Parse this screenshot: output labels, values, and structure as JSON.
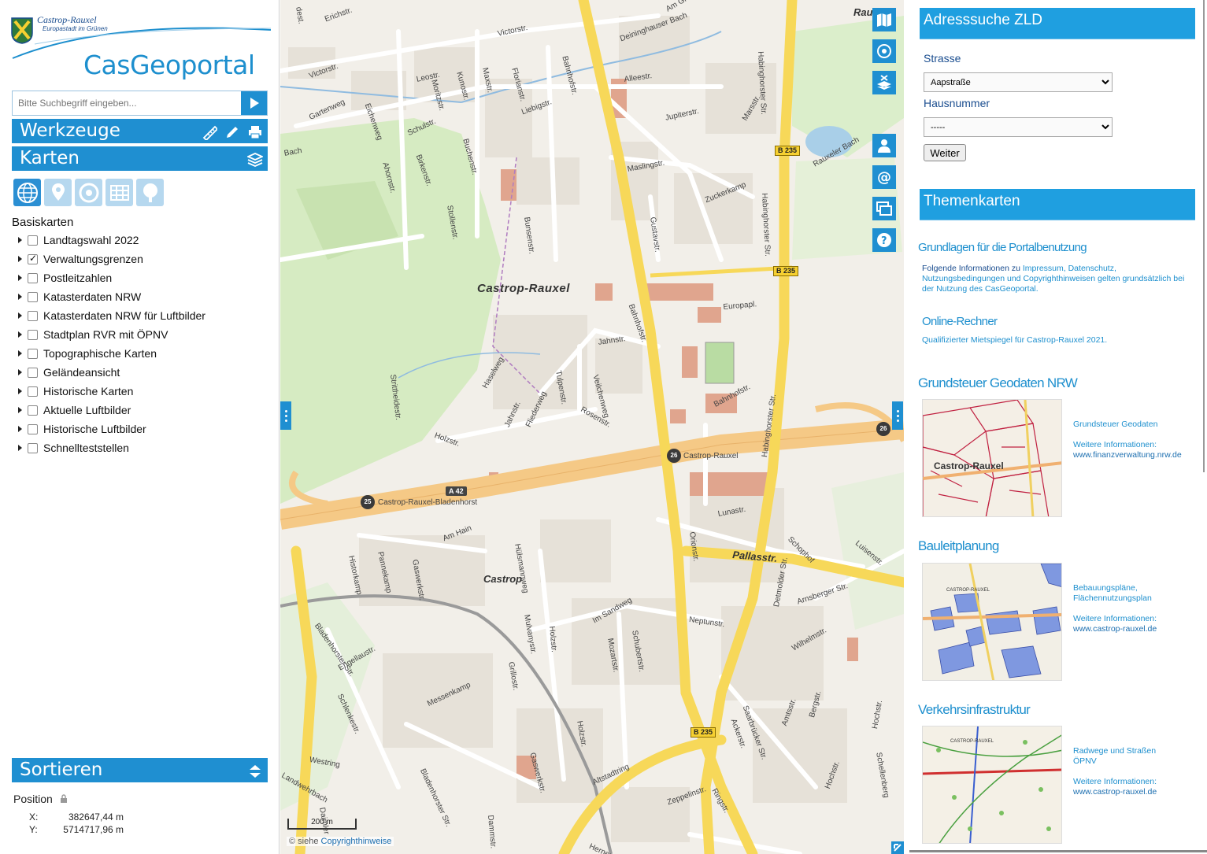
{
  "brand": {
    "city": "Castrop-Rauxel",
    "tagline": "Europastadt im Grünen",
    "title": "CasGeoportal"
  },
  "search": {
    "placeholder": "Bitte Suchbegriff eingeben..."
  },
  "sections": {
    "werkzeuge": "Werkzeuge",
    "karten": "Karten",
    "sortieren": "Sortieren"
  },
  "basiskarten": {
    "title": "Basiskarten",
    "layers": [
      {
        "label": "Landtagswahl 2022",
        "checked": false
      },
      {
        "label": "Verwaltungsgrenzen",
        "checked": true
      },
      {
        "label": "Postleitzahlen",
        "checked": false
      },
      {
        "label": "Katasterdaten NRW",
        "checked": false
      },
      {
        "label": "Katasterdaten NRW für Luftbilder",
        "checked": false
      },
      {
        "label": "Stadtplan RVR mit ÖPNV",
        "checked": false
      },
      {
        "label": "Topographische Karten",
        "checked": false
      },
      {
        "label": "Geländeansicht",
        "checked": false
      },
      {
        "label": "Historische Karten",
        "checked": false
      },
      {
        "label": "Aktuelle Luftbilder",
        "checked": false
      },
      {
        "label": "Historische Luftbilder",
        "checked": false
      },
      {
        "label": "Schnellteststellen",
        "checked": false
      }
    ]
  },
  "position": {
    "label": "Position",
    "x_label": "X:",
    "x_value": "382647,44 m",
    "y_label": "Y:",
    "y_value": "5714717,96 m"
  },
  "map": {
    "labels": {
      "victorstr": "Victorstr.",
      "victorstr2": "Victorstr.",
      "erichstr": "Erichstr.",
      "leostr": "Leostr.",
      "gartenweg": "Gartenweg",
      "eichenweg": "Eichenweg",
      "moritzstr": "Moritzstr.",
      "kunostr": "Kunostr.",
      "maxstr": "Maxstr.",
      "florianstr": "Florianstr.",
      "bahnhofstr": "Bahnhofstr.",
      "bahnhofstr2": "Bahnhofstr.",
      "amgraben": "Am Graben",
      "deininghauser": "Deininghauser Bach",
      "alleestr": "Alleestr.",
      "liebigstr": "Liebigstr.",
      "schulstr": "Schulstr.",
      "birkenstr": "Birkenstr.",
      "buchenstr": "Buchenstr.",
      "ahornstr": "Ahornstr.",
      "jupiterstr": "Jupiterstr.",
      "marsstr": "Marsstr.",
      "maslingstr": "Maslingstr.",
      "zuckerkamp": "Zuckerkamp",
      "gustavstr": "Gustavstr.",
      "bunsenstr": "Bunsenstr.",
      "stollenstr": "Stollenstr.",
      "habinghorster": "Habinghorster Str.",
      "habinghorster2": "Habinghorster Str.",
      "habinghorster3": "Habinghorster Str.",
      "rauxelerbach": "Rauxeler Bach",
      "bach": "Bach",
      "castroprauxel": "Castrop-Rauxel",
      "europapl": "Europapl.",
      "jahnstr": "Jahnstr.",
      "tulpenstr": "Tulpenstr.",
      "veilchenweg": "Veilchenweg",
      "rosenstr": "Rosenstr.",
      "haselweg": "Haselweg",
      "jahnstr2": "Jahnstr.",
      "fliederweg": "Fliederweg",
      "holzstr": "Holzstr.",
      "strittheidestr": "Strittheidestr.",
      "bahnhofstr3": "Bahnhofstr.",
      "junction_castrop": "Castrop-Rauxel",
      "junction_bladenhorst": "Castrop-Rauxel-Bladenhorst",
      "lunastr": "Lunastr.",
      "orionstr": "Orionstr.",
      "schophof": "Schophof",
      "luisenstr": "Luisenstr.",
      "pallasstr": "Pallasstr.",
      "amhain": "Am Hain",
      "hulsmannweg": "Hülsmannweg",
      "pannekamp": "Pannekamp",
      "gaswerkstr": "Gaswerkstr.",
      "historkamp": "Historkamp",
      "castrop": "Castrop",
      "arnsberger": "Arnsberger Str.",
      "detmolder": "Detmolder Str.",
      "neptunstr": "Neptunstr.",
      "imsandweg": "Im Sandweg",
      "mozartstr": "Mozartstr.",
      "schubertstr": "Schubertstr.",
      "holzstr2": "Holzstr.",
      "mulvanystr": "Mulvanystr.",
      "grillostr": "Grillostr.",
      "bladenhorster": "Bladenhorster Str.",
      "engellaustr": "Engellaustr.",
      "schlenkestr": "Schlenkestr.",
      "wilhelmstr": "Wilhelmstr.",
      "saarbruecker": "Saarbrücker Str.",
      "ackerstr": "Ackerstr.",
      "amtsstr": "Amtsstr.",
      "bergstr": "Bergstr.",
      "hochstr": "Hochstr.",
      "messenkamp": "Messenkamp",
      "westring": "Westring",
      "bladenhorster2": "Bladenhorster Str.",
      "gaswerkstr2": "Gaswerkstr.",
      "holzstr3": "Holzstr.",
      "altstadtring": "Altstadtring",
      "ringstr": "Ringstr.",
      "zeppelinstr": "Zeppelinstr.",
      "dammstr": "Dammstr.",
      "hernerstr": "Herner Str.",
      "daimlerstr": "Daimler",
      "landwehrbach": "Landwehrbach",
      "hochstr2": "Hochstr.",
      "schellenberg": "Schellenberg",
      "rau": "Rau",
      "ahlstr": "dest."
    },
    "shields": {
      "b235_1": "B 235",
      "b235_2": "B 235",
      "b235_3": "B 235",
      "a42": "A 42"
    },
    "junctions": {
      "j26": "26",
      "j25": "25",
      "j26r": "26"
    },
    "scale": "200 m",
    "copyright_prefix": "© siehe",
    "copyright_link": "Copyrighthinweise"
  },
  "adresssuche": {
    "title": "Adresssuche ZLD",
    "strasse_label": "Strasse",
    "strasse_value": "Aapstraße",
    "hausnummer_label": "Hausnummer",
    "hausnummer_value": "-----",
    "weiter": "Weiter"
  },
  "themenkarten": {
    "title": "Themenkarten",
    "grundlagen_title": "Grundlagen für die Portalbenutzung",
    "grundlagen_lead": "Folgende Informationen zu",
    "grundlagen_text": "Impressum, Datenschutz, Nutzungsbedingungen und Copyrighthinweisen gelten grundsätzlich bei der Nutzung des CasGeoportal.",
    "rechner_title": "Online-Rechner",
    "rechner_text": "Qualifizierter Mietspiegel für Castrop-Rauxel 2021.",
    "items": [
      {
        "title": "Grundsteuer Geodaten NRW",
        "caption": "Grundsteuer Geodaten",
        "info": "Weitere Informationen:",
        "link": "www.finanzverwaltung.nrw.de"
      },
      {
        "title": "Bauleitplanung",
        "caption": "Bebauungspläne, Flächennutzungsplan",
        "info": "Weitere Informationen:",
        "link": "www.castrop-rauxel.de"
      },
      {
        "title": "Verkehrsinfrastruktur",
        "caption": "Radwege und Straßen ÖPNV",
        "info": "Weitere Informationen:",
        "link": "www.castrop-rauxel.de"
      }
    ],
    "thumb_labels": {
      "grund_city": "Castrop-Rauxel",
      "bau_city": "CASTROP-RAUXEL",
      "verkehr_city": "CASTROP-RAUXEL"
    }
  },
  "colors": {
    "accent": "#1f8fd1",
    "header_blue": "#1f9fe0",
    "road_yellow": "#f7d859",
    "road_orange": "#f5c986"
  }
}
